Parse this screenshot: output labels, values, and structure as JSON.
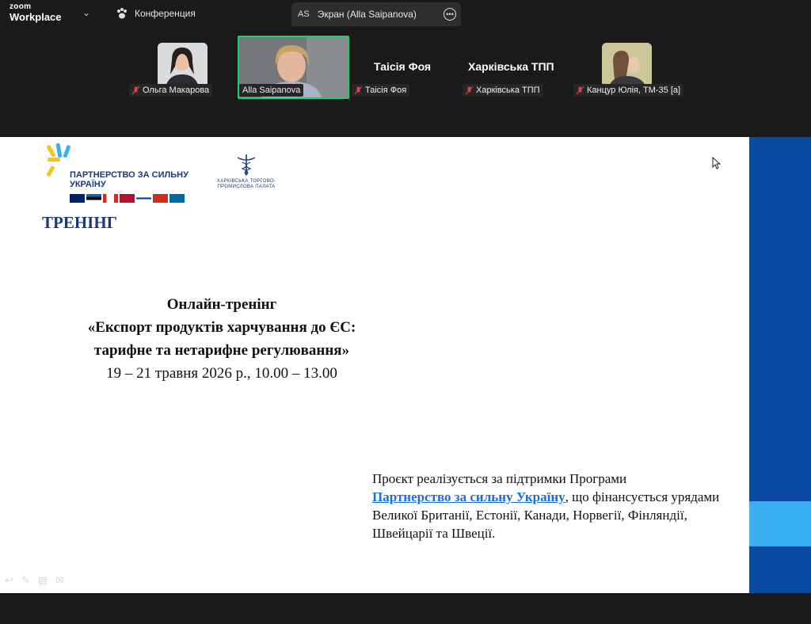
{
  "app": {
    "brand_top": "zoom",
    "brand_bottom": "Workplace",
    "conference_label": "Конференция",
    "screen_tab_initials": "AS",
    "screen_tab_label": "Экран (Alla Saipanova)"
  },
  "participants": [
    {
      "name": "Ольга Макарова",
      "muted": true,
      "video": true
    },
    {
      "name": "Alla Saipanova",
      "muted": false,
      "video": true,
      "active_speaker": true
    },
    {
      "name": "Таісія Фоя",
      "muted": true,
      "video": false,
      "display_name": "Таісія Фоя"
    },
    {
      "name": "Харківська ТПП",
      "muted": true,
      "video": false,
      "display_name": "Харківська ТПП"
    },
    {
      "name": "Канцур Юлія, ТМ-35 [а]",
      "muted": true,
      "video": true
    }
  ],
  "slide": {
    "partner_logo_text": "ПАРТНЕРСТВО ЗА СИЛЬНУ УКРАЇНУ",
    "htpp_logo_text": "ХАРКІВСЬКА ТОРГОВО-ПРОМИСЛОВА ПАЛАТА",
    "training_label": "ТРЕНІНГ",
    "line1": "Онлайн-тренінг",
    "line2": "«Експорт продуктів харчування до ЄС:",
    "line3": "тарифне та нетарифне регулювання»",
    "line4": "19 – 21 травня 2026 р., 10.00 – 13.00",
    "support_prefix": "Проєкт реалізується за підтримки Програми",
    "support_link": "Партнерство за сильну Україну",
    "support_suffix": ", що фінансується урядами Великої Британії, Естонії, Канади, Норвегії, Фінляндії, Швейцарії та Швеції."
  },
  "colors": {
    "accent_blue": "#0b4aa2",
    "light_blue": "#3ab0f0",
    "active_border": "#1fcf6a",
    "logo_yellow": "#f5c518",
    "logo_navy": "#1a3a7a"
  }
}
